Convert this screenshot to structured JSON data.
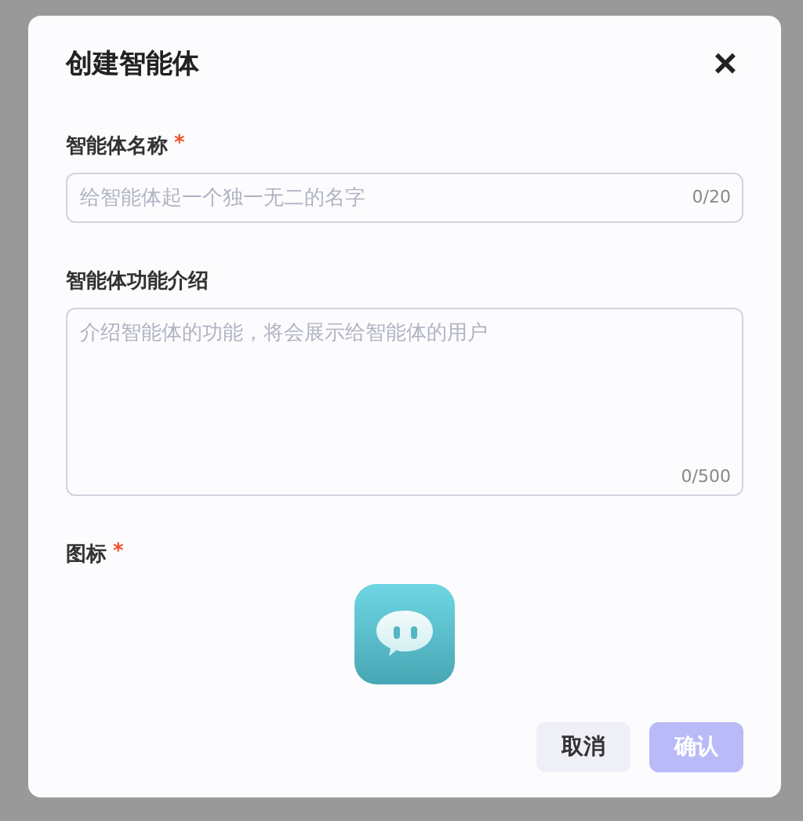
{
  "dialog": {
    "title": "创建智能体",
    "close": "×",
    "fields": [
      {
        "kind": "input",
        "label": "智能体名称",
        "required_mark": "*",
        "placeholder": "给智能体起一个独一无二的名字",
        "count": "0/20"
      },
      {
        "kind": "textarea",
        "label": "智能体功能介绍",
        "placeholder": "介绍智能体的功能，将会展示给智能体的用户",
        "count": "0/500"
      },
      {
        "kind": "icon",
        "label": "图标",
        "required_mark": "*"
      }
    ],
    "buttons": [
      {
        "label": "取消",
        "kind": "secondary",
        "disabled": false
      },
      {
        "label": "确认",
        "kind": "primary",
        "disabled": true
      }
    ]
  }
}
